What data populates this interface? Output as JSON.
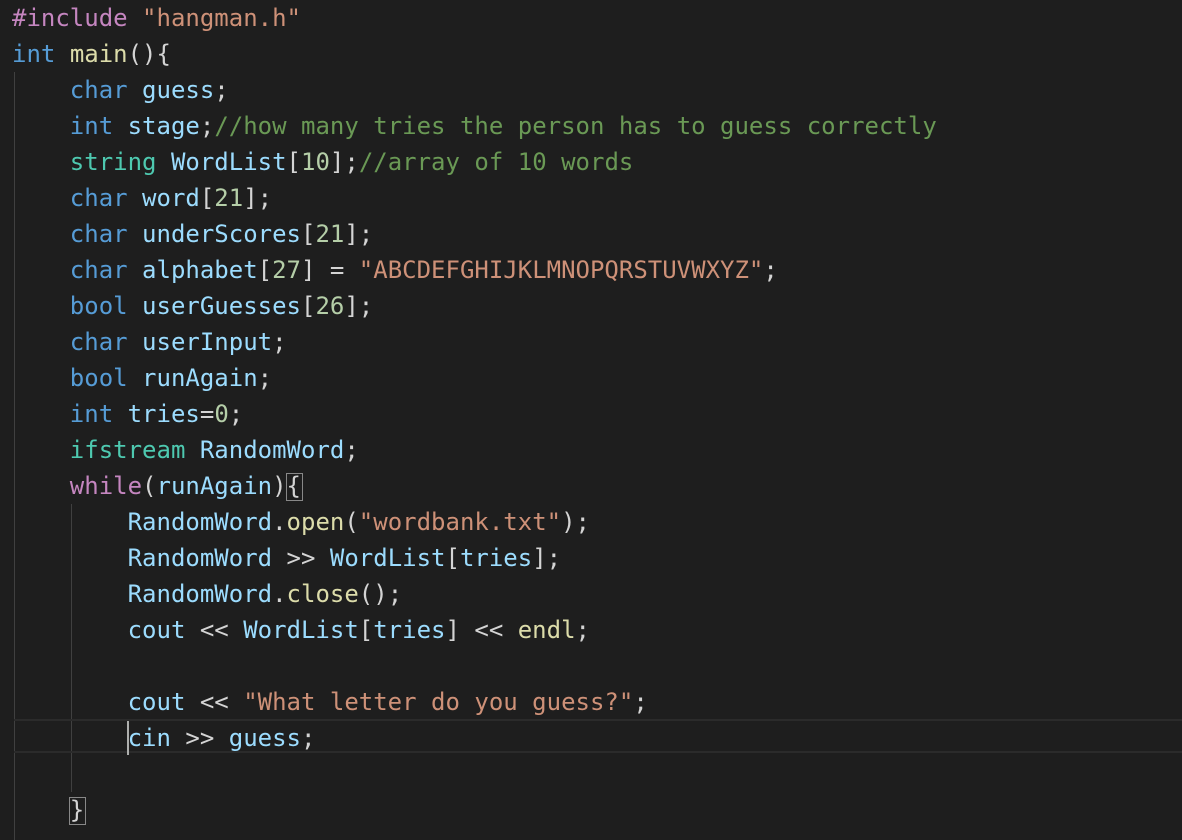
{
  "lines": [
    {
      "tokens": [
        {
          "t": "#include",
          "c": "pp"
        },
        {
          "t": " ",
          "c": "p"
        },
        {
          "t": "\"hangman.h\"",
          "c": "str"
        }
      ]
    },
    {
      "tokens": [
        {
          "t": "int",
          "c": "kw"
        },
        {
          "t": " ",
          "c": "p"
        },
        {
          "t": "main",
          "c": "fn"
        },
        {
          "t": "(){",
          "c": "p"
        }
      ]
    },
    {
      "tokens": [
        {
          "t": "    ",
          "c": "p"
        },
        {
          "t": "char",
          "c": "kw"
        },
        {
          "t": " ",
          "c": "p"
        },
        {
          "t": "guess",
          "c": "var"
        },
        {
          "t": ";",
          "c": "p"
        }
      ]
    },
    {
      "tokens": [
        {
          "t": "    ",
          "c": "p"
        },
        {
          "t": "int",
          "c": "kw"
        },
        {
          "t": " ",
          "c": "p"
        },
        {
          "t": "stage",
          "c": "var"
        },
        {
          "t": ";",
          "c": "p"
        },
        {
          "t": "//how many tries the person has to guess correctly",
          "c": "cm"
        }
      ]
    },
    {
      "tokens": [
        {
          "t": "    ",
          "c": "p"
        },
        {
          "t": "string",
          "c": "type"
        },
        {
          "t": " ",
          "c": "p"
        },
        {
          "t": "WordList",
          "c": "var"
        },
        {
          "t": "[",
          "c": "p"
        },
        {
          "t": "10",
          "c": "num"
        },
        {
          "t": "];",
          "c": "p"
        },
        {
          "t": "//array of 10 words",
          "c": "cm"
        }
      ]
    },
    {
      "tokens": [
        {
          "t": "    ",
          "c": "p"
        },
        {
          "t": "char",
          "c": "kw"
        },
        {
          "t": " ",
          "c": "p"
        },
        {
          "t": "word",
          "c": "var"
        },
        {
          "t": "[",
          "c": "p"
        },
        {
          "t": "21",
          "c": "num"
        },
        {
          "t": "];",
          "c": "p"
        }
      ]
    },
    {
      "tokens": [
        {
          "t": "    ",
          "c": "p"
        },
        {
          "t": "char",
          "c": "kw"
        },
        {
          "t": " ",
          "c": "p"
        },
        {
          "t": "underScores",
          "c": "var"
        },
        {
          "t": "[",
          "c": "p"
        },
        {
          "t": "21",
          "c": "num"
        },
        {
          "t": "];",
          "c": "p"
        }
      ]
    },
    {
      "tokens": [
        {
          "t": "    ",
          "c": "p"
        },
        {
          "t": "char",
          "c": "kw"
        },
        {
          "t": " ",
          "c": "p"
        },
        {
          "t": "alphabet",
          "c": "var"
        },
        {
          "t": "[",
          "c": "p"
        },
        {
          "t": "27",
          "c": "num"
        },
        {
          "t": "] = ",
          "c": "p"
        },
        {
          "t": "\"ABCDEFGHIJKLMNOPQRSTUVWXYZ\"",
          "c": "str"
        },
        {
          "t": ";",
          "c": "p"
        }
      ]
    },
    {
      "tokens": [
        {
          "t": "    ",
          "c": "p"
        },
        {
          "t": "bool",
          "c": "kw"
        },
        {
          "t": " ",
          "c": "p"
        },
        {
          "t": "userGuesses",
          "c": "var"
        },
        {
          "t": "[",
          "c": "p"
        },
        {
          "t": "26",
          "c": "num"
        },
        {
          "t": "];",
          "c": "p"
        }
      ]
    },
    {
      "tokens": [
        {
          "t": "    ",
          "c": "p"
        },
        {
          "t": "char",
          "c": "kw"
        },
        {
          "t": " ",
          "c": "p"
        },
        {
          "t": "userInput",
          "c": "var"
        },
        {
          "t": ";",
          "c": "p"
        }
      ]
    },
    {
      "tokens": [
        {
          "t": "    ",
          "c": "p"
        },
        {
          "t": "bool",
          "c": "kw"
        },
        {
          "t": " ",
          "c": "p"
        },
        {
          "t": "runAgain",
          "c": "var"
        },
        {
          "t": ";",
          "c": "p"
        }
      ]
    },
    {
      "tokens": [
        {
          "t": "    ",
          "c": "p"
        },
        {
          "t": "int",
          "c": "kw"
        },
        {
          "t": " ",
          "c": "p"
        },
        {
          "t": "tries",
          "c": "var"
        },
        {
          "t": "=",
          "c": "p"
        },
        {
          "t": "0",
          "c": "num"
        },
        {
          "t": ";",
          "c": "p"
        }
      ]
    },
    {
      "tokens": [
        {
          "t": "    ",
          "c": "p"
        },
        {
          "t": "ifstream",
          "c": "type"
        },
        {
          "t": " ",
          "c": "p"
        },
        {
          "t": "RandomWord",
          "c": "var"
        },
        {
          "t": ";",
          "c": "p"
        }
      ]
    },
    {
      "tokens": [
        {
          "t": "    ",
          "c": "p"
        },
        {
          "t": "while",
          "c": "ctrl"
        },
        {
          "t": "(",
          "c": "p"
        },
        {
          "t": "runAgain",
          "c": "var"
        },
        {
          "t": "){",
          "c": "p"
        }
      ]
    },
    {
      "tokens": [
        {
          "t": "        ",
          "c": "p"
        },
        {
          "t": "RandomWord",
          "c": "var"
        },
        {
          "t": ".",
          "c": "p"
        },
        {
          "t": "open",
          "c": "fn"
        },
        {
          "t": "(",
          "c": "p"
        },
        {
          "t": "\"wordbank.txt\"",
          "c": "str"
        },
        {
          "t": ");",
          "c": "p"
        }
      ]
    },
    {
      "tokens": [
        {
          "t": "        ",
          "c": "p"
        },
        {
          "t": "RandomWord",
          "c": "var"
        },
        {
          "t": " >> ",
          "c": "p"
        },
        {
          "t": "WordList",
          "c": "var"
        },
        {
          "t": "[",
          "c": "p"
        },
        {
          "t": "tries",
          "c": "var"
        },
        {
          "t": "];",
          "c": "p"
        }
      ]
    },
    {
      "tokens": [
        {
          "t": "        ",
          "c": "p"
        },
        {
          "t": "RandomWord",
          "c": "var"
        },
        {
          "t": ".",
          "c": "p"
        },
        {
          "t": "close",
          "c": "fn"
        },
        {
          "t": "();",
          "c": "p"
        }
      ]
    },
    {
      "tokens": [
        {
          "t": "        ",
          "c": "p"
        },
        {
          "t": "cout",
          "c": "var"
        },
        {
          "t": " << ",
          "c": "p"
        },
        {
          "t": "WordList",
          "c": "var"
        },
        {
          "t": "[",
          "c": "p"
        },
        {
          "t": "tries",
          "c": "var"
        },
        {
          "t": "] << ",
          "c": "p"
        },
        {
          "t": "endl",
          "c": "fn"
        },
        {
          "t": ";",
          "c": "p"
        }
      ]
    },
    {
      "tokens": []
    },
    {
      "tokens": [
        {
          "t": "        ",
          "c": "p"
        },
        {
          "t": "cout",
          "c": "var"
        },
        {
          "t": " << ",
          "c": "p"
        },
        {
          "t": "\"What letter do you guess?\"",
          "c": "str"
        },
        {
          "t": ";",
          "c": "p"
        }
      ]
    },
    {
      "tokens": [
        {
          "t": "        ",
          "c": "p"
        },
        {
          "t": "cin",
          "c": "var"
        },
        {
          "t": " >> ",
          "c": "p"
        },
        {
          "t": "guess",
          "c": "var"
        },
        {
          "t": ";",
          "c": "p"
        }
      ]
    },
    {
      "tokens": []
    },
    {
      "tokens": [
        {
          "t": "    ",
          "c": "p"
        },
        {
          "t": "}",
          "c": "p"
        }
      ]
    }
  ]
}
